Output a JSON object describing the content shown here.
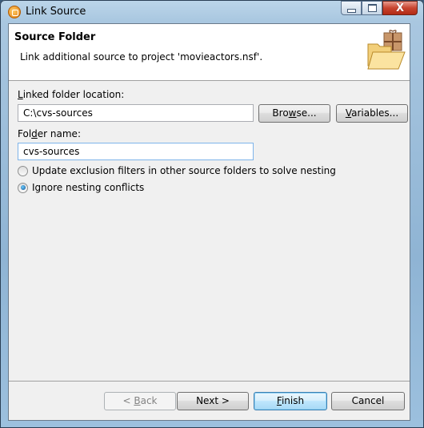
{
  "window": {
    "title": "Link Source",
    "icon": "link-source-app-icon",
    "controls": {
      "minimize": "minimize-icon",
      "maximize": "maximize-icon",
      "close_glyph": "X"
    }
  },
  "banner": {
    "title": "Source Folder",
    "description": "Link additional source to project 'movieactors.nsf'.",
    "icon": "folder-with-package-icon"
  },
  "form": {
    "location_label": {
      "accel": "L",
      "rest": "inked folder location:"
    },
    "location_value": "C:\\cvs-sources",
    "browse_button": {
      "pre": "Bro",
      "accel": "w",
      "post": "se..."
    },
    "variables_button": {
      "pre": "",
      "accel": "V",
      "post": "ariables..."
    },
    "folder_name_label": {
      "pre": "Fol",
      "accel": "d",
      "post": "er name:"
    },
    "folder_name_value": "cvs-sources",
    "options": [
      {
        "label": "Update exclusion filters in other source folders to solve nesting",
        "checked": false
      },
      {
        "label": "Ignore nesting conflicts",
        "checked": true
      }
    ]
  },
  "footer": {
    "back_button": {
      "pre": "< ",
      "accel": "B",
      "post": "ack",
      "enabled": false
    },
    "next_button": {
      "label": "Next >",
      "enabled": true
    },
    "finish_button": {
      "pre": "",
      "accel": "F",
      "post": "inish",
      "default": true
    },
    "cancel_button": {
      "label": "Cancel"
    }
  }
}
